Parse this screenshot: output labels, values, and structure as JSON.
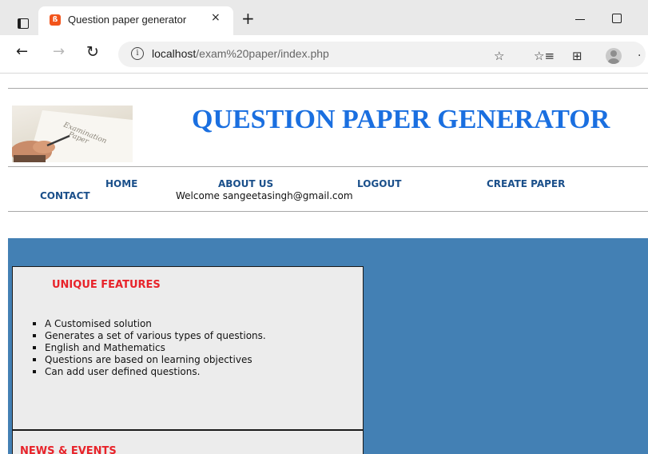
{
  "browser": {
    "tab_title": "Question paper generator",
    "tab_close": "×",
    "new_tab": "+",
    "url_host": "localhost",
    "url_path": "/exam%20paper/index.php",
    "icons": [
      "tab-actions-icon",
      "favicon-icon",
      "close-icon",
      "new-tab-icon",
      "minimize-icon",
      "maximize-icon",
      "back-icon",
      "forward-icon",
      "reload-icon",
      "info-icon",
      "add-favorite-icon",
      "favorites-icon",
      "collections-icon",
      "profile-avatar",
      "more-icon"
    ]
  },
  "header": {
    "logo_text": "Examination Paper",
    "title": "QUESTION PAPER GENERATOR",
    "title_color": "#1a6fe0"
  },
  "menu": {
    "home": "HOME",
    "about": "ABOUT US",
    "logout": "LOGOUT",
    "create": "CREATE PAPER",
    "contact": "CONTACT",
    "link_color": "#1a4f8a",
    "welcome": "Welcome sangeetasingh@gmail.com"
  },
  "main": {
    "background_color": "#4380b4",
    "features": {
      "heading": "UNIQUE FEATURES",
      "items": [
        "A Customised solution",
        "Generates a set of various types of questions.",
        "English and Mathematics",
        "Questions are based on learning objectives",
        "Can add user defined questions."
      ]
    },
    "news": {
      "heading": "NEWS & EVENTS"
    },
    "heading_color": "#e8232a"
  }
}
